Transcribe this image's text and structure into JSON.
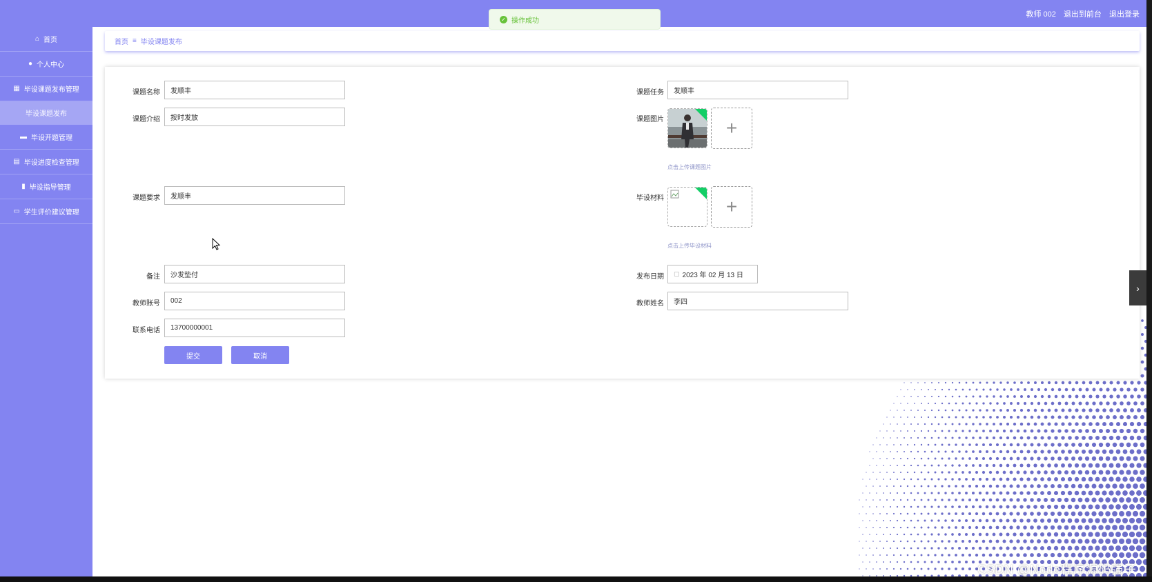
{
  "topbar": {
    "user": "教师 002",
    "goto_front": "退出到前台",
    "logout": "退出登录"
  },
  "toast": {
    "message": "操作成功"
  },
  "sidebar": {
    "items": [
      {
        "label": "首页",
        "icon": "home-icon"
      },
      {
        "label": "个人中心",
        "icon": "user-icon"
      },
      {
        "label": "毕设课题发布管理",
        "icon": "grid-icon"
      },
      {
        "label": "毕设课题发布",
        "sub": true
      },
      {
        "label": "毕设开题管理",
        "icon": "briefcase-icon"
      },
      {
        "label": "毕设进度检查管理",
        "icon": "table-icon"
      },
      {
        "label": "毕设指导管理",
        "icon": "clipboard-icon"
      },
      {
        "label": "学生评价建议管理",
        "icon": "ticket-icon"
      }
    ]
  },
  "breadcrumb": {
    "home": "首页",
    "separator": "≡",
    "current": "毕设课题发布"
  },
  "form": {
    "title_label": "课题名称",
    "title_value": "发顺丰",
    "task_label": "课题任务",
    "task_value": "发顺丰",
    "intro_label": "课题介绍",
    "intro_value": "按时发放",
    "image_label": "课题图片",
    "image_hint": "点击上传课题图片",
    "req_label": "课题要求",
    "req_value": "发顺丰",
    "material_label": "毕设材料",
    "material_hint": "点击上传毕设材料",
    "remark_label": "备注",
    "remark_value": "沙发垫付",
    "date_label": "发布日期",
    "date_value": "2023 年 02 月 13 日",
    "teacher_no_label": "教师账号",
    "teacher_no_value": "002",
    "teacher_name_label": "教师姓名",
    "teacher_name_value": "李四",
    "phone_label": "联系电话",
    "phone_value": "13700000001",
    "submit": "提交",
    "cancel": "取消"
  },
  "watermark": "CSDN @Node程序源码强子",
  "colors": {
    "primary": "#8384f1",
    "success": "#67c23a",
    "dots": "#6c6ec9"
  }
}
